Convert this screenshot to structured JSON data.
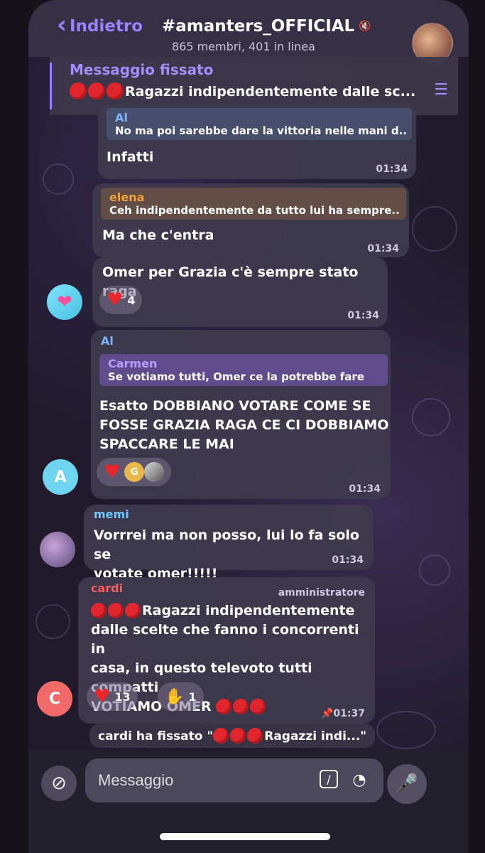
{
  "header": {
    "back_label": "Indietro",
    "title": "#amanters_OFFICIAL",
    "subtitle": "865 membri, 401 in linea"
  },
  "pinned": {
    "label": "Messaggio fissato",
    "text": "Ragazzi indipendentemente dalle sc..."
  },
  "messages": [
    {
      "reply_name": "Al",
      "reply_text": "No ma poi sarebbe dare la vittoria nelle mani d...",
      "text": "Infatti",
      "time": "01:34"
    },
    {
      "reply_name": "elena",
      "reply_text": "Ceh indipendentemente da tutto lui ha sempre...",
      "text": "Ma che c'entra",
      "time": "01:34"
    },
    {
      "text": "Omer per Grazia c'è sempre stato raga",
      "reaction_count": "4",
      "time": "01:34"
    },
    {
      "sender": "Al",
      "reply_name": "Carmen",
      "reply_text": "Se votiamo tutti, Omer ce la potrebbe fare",
      "line1": "Esatto DOBBIANO VOTARE COME SE",
      "line2": "FOSSE GRAZIA RAGA CE CI DOBBIAMO",
      "line3": "SPACCARE LE MAI",
      "reaction_avatar": "G",
      "avatar": "A",
      "time": "01:34"
    },
    {
      "sender": "memi",
      "line1": "Vorrrei ma non posso, lui lo fa solo se",
      "line2": "votate omer!!!!!",
      "time": "01:34"
    },
    {
      "sender": "cardi",
      "role": "amministratore",
      "line1": "Ragazzi indipendentemente",
      "line2": "dalle scelte che fanno i concorrenti in",
      "line3": "casa, in questo televoto tutti compatti",
      "line4": "VOTIAMO OMER",
      "reaction1_count": "13",
      "reaction2_count": "1",
      "avatar": "C",
      "time": "01:37"
    }
  ],
  "service": {
    "prefix": "cardi ha fissato \"",
    "suffix": "Ragazzi indi...\""
  },
  "input": {
    "placeholder": "Messaggio"
  },
  "colors": {
    "accent": "#9a82ff",
    "name_al": "#7fb4ff",
    "name_elena": "#f0a23c",
    "name_carmen": "#b99cff",
    "name_memi": "#6fc7ff",
    "name_cardi": "#ff5a5a",
    "heart": "#e8262c"
  },
  "icons": [
    "back-chevron-icon",
    "mute-icon",
    "pin-icon",
    "heart-icon",
    "clap-icon",
    "attach-icon",
    "command-icon",
    "timer-icon",
    "microphone-icon",
    "red-circle-emoji"
  ]
}
